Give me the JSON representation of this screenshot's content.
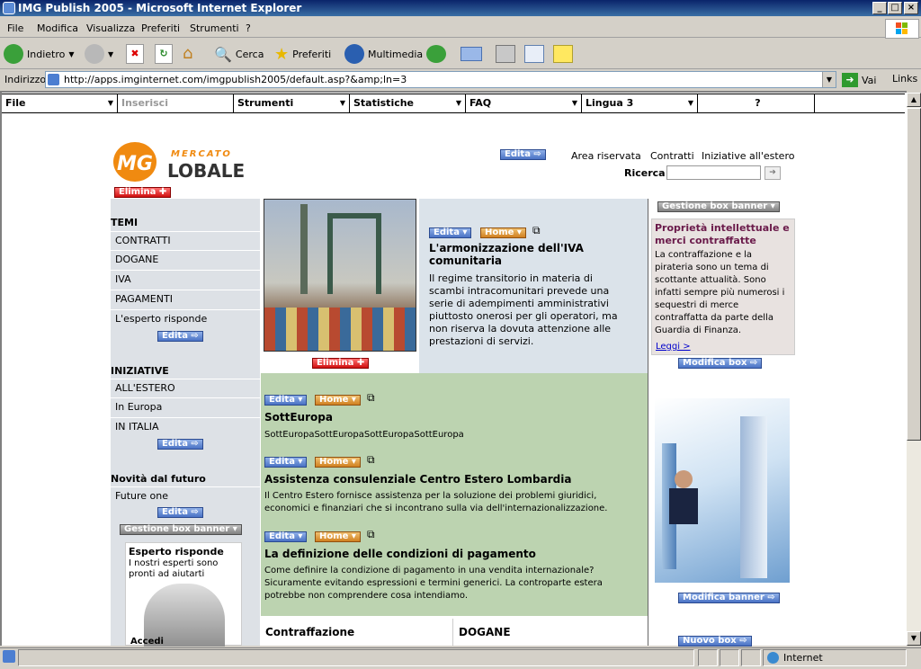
{
  "window": {
    "title": "IMG Publish 2005 - Microsoft Internet Explorer"
  },
  "menu": [
    "File",
    "Modifica",
    "Visualizza",
    "Preferiti",
    "Strumenti",
    "?"
  ],
  "toolbar": {
    "back": "Indietro",
    "search": "Cerca",
    "favorites": "Preferiti",
    "media": "Multimedia"
  },
  "address": {
    "label": "Indirizzo",
    "url": "http://apps.imginternet.com/imgpublish2005/default.asp?&amp;ln=3",
    "go": "Vai",
    "links": "Links"
  },
  "appmenu": [
    "File",
    "Inserisci",
    "Strumenti",
    "Statistiche",
    "FAQ",
    "Lingua 3",
    "?"
  ],
  "header": {
    "links": [
      "Area riservata",
      "Contratti",
      "Iniziative all'estero"
    ],
    "search_label": "Ricerca",
    "logo_top": "MERCATO",
    "logo_bottom": "LOBALE",
    "logo_mg": "MG"
  },
  "buttons": {
    "edita": "Edita",
    "home": "Home",
    "elimina": "Elimina",
    "gestione": "Gestione box banner",
    "modifica_box": "Modifica box",
    "modifica_banner": "Modifica banner",
    "nuovo_box": "Nuovo box"
  },
  "left": {
    "temi_title": "TEMI",
    "temi": [
      "CONTRATTI",
      "DOGANE",
      "IVA",
      "PAGAMENTI",
      "L'esperto risponde"
    ],
    "iniz_title": "INIZIATIVE",
    "iniziative": [
      "ALL'ESTERO",
      "In Europa",
      "IN ITALIA"
    ],
    "novita_title": "Novità dal futuro",
    "novita": [
      "Future one"
    ],
    "banner_title": "Esperto risponde",
    "banner_text": "I nostri esperti sono pronti ad aiutarti",
    "banner_link": "Accedi"
  },
  "main": {
    "article": {
      "title": "L'armonizzazione dell'IVA comunitaria",
      "text": "Il regime transitorio in materia di scambi intracomunitari prevede una serie di adempimenti amministrativi piuttosto onerosi per gli operatori, ma non riserva la dovuta attenzione alle prestazioni di servizi."
    },
    "news": [
      {
        "title": "SottEuropa",
        "text": "SottEuropaSottEuropaSottEuropaSottEuropa"
      },
      {
        "title": "Assistenza consulenziale Centro Estero Lombardia",
        "text": "Il Centro Estero fornisce assistenza per la soluzione dei problemi giuridici, economici e finanziari che si incontrano sulla via dell'internazionalizzazione."
      },
      {
        "title": "La definizione delle condizioni di pagamento",
        "text": "Come definire la condizione di pagamento in una vendita internazionale? Sicuramente evitando espressioni e termini generici. La controparte estera potrebbe non comprendere cosa intendiamo."
      }
    ],
    "bottom": [
      "Contraffazione",
      "DOGANE"
    ]
  },
  "right": {
    "box_title": "Proprietà intellettuale e merci contraffatte",
    "box_text": "La contraffazione e la pirateria sono un tema di scottante attualità. Sono infatti sempre più numerosi i sequestri di merce contraffatta da parte della Guardia di Finanza.",
    "box_link": "Leggi >"
  },
  "status": {
    "zone": "Internet"
  }
}
